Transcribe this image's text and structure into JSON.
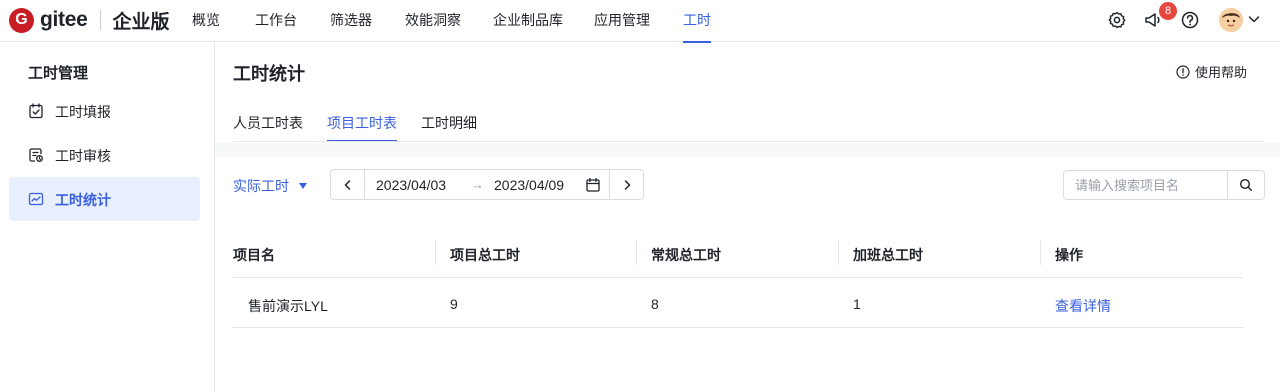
{
  "brand": {
    "badge": "G",
    "name": "gitee",
    "edition": "企业版"
  },
  "nav": {
    "items": [
      {
        "label": "概览"
      },
      {
        "label": "工作台"
      },
      {
        "label": "筛选器"
      },
      {
        "label": "效能洞察"
      },
      {
        "label": "企业制品库"
      },
      {
        "label": "应用管理"
      },
      {
        "label": "工时",
        "active": true
      }
    ],
    "notification_count": "8",
    "accent_color": "#3a60e0"
  },
  "sidebar": {
    "title": "工时管理",
    "items": [
      {
        "label": "工时填报",
        "icon": "checkbox-calendar-icon"
      },
      {
        "label": "工时审核",
        "icon": "review-icon"
      },
      {
        "label": "工时统计",
        "icon": "chart-icon",
        "active": true
      }
    ]
  },
  "page": {
    "title": "工时统计",
    "help_label": "使用帮助",
    "tabs": [
      {
        "label": "人员工时表"
      },
      {
        "label": "项目工时表",
        "active": true
      },
      {
        "label": "工时明细"
      }
    ]
  },
  "filters": {
    "hour_type": "实际工时",
    "date_start": "2023/04/03",
    "date_arrow": "→",
    "date_end": "2023/04/09",
    "search_placeholder": "请输入搜索项目名"
  },
  "table": {
    "headers": [
      "项目名",
      "项目总工时",
      "常规总工时",
      "加班总工时",
      "操作"
    ],
    "rows": [
      {
        "name": "售前演示LYL",
        "total": "9",
        "regular": "8",
        "overtime": "1",
        "action": "查看详情"
      }
    ]
  }
}
